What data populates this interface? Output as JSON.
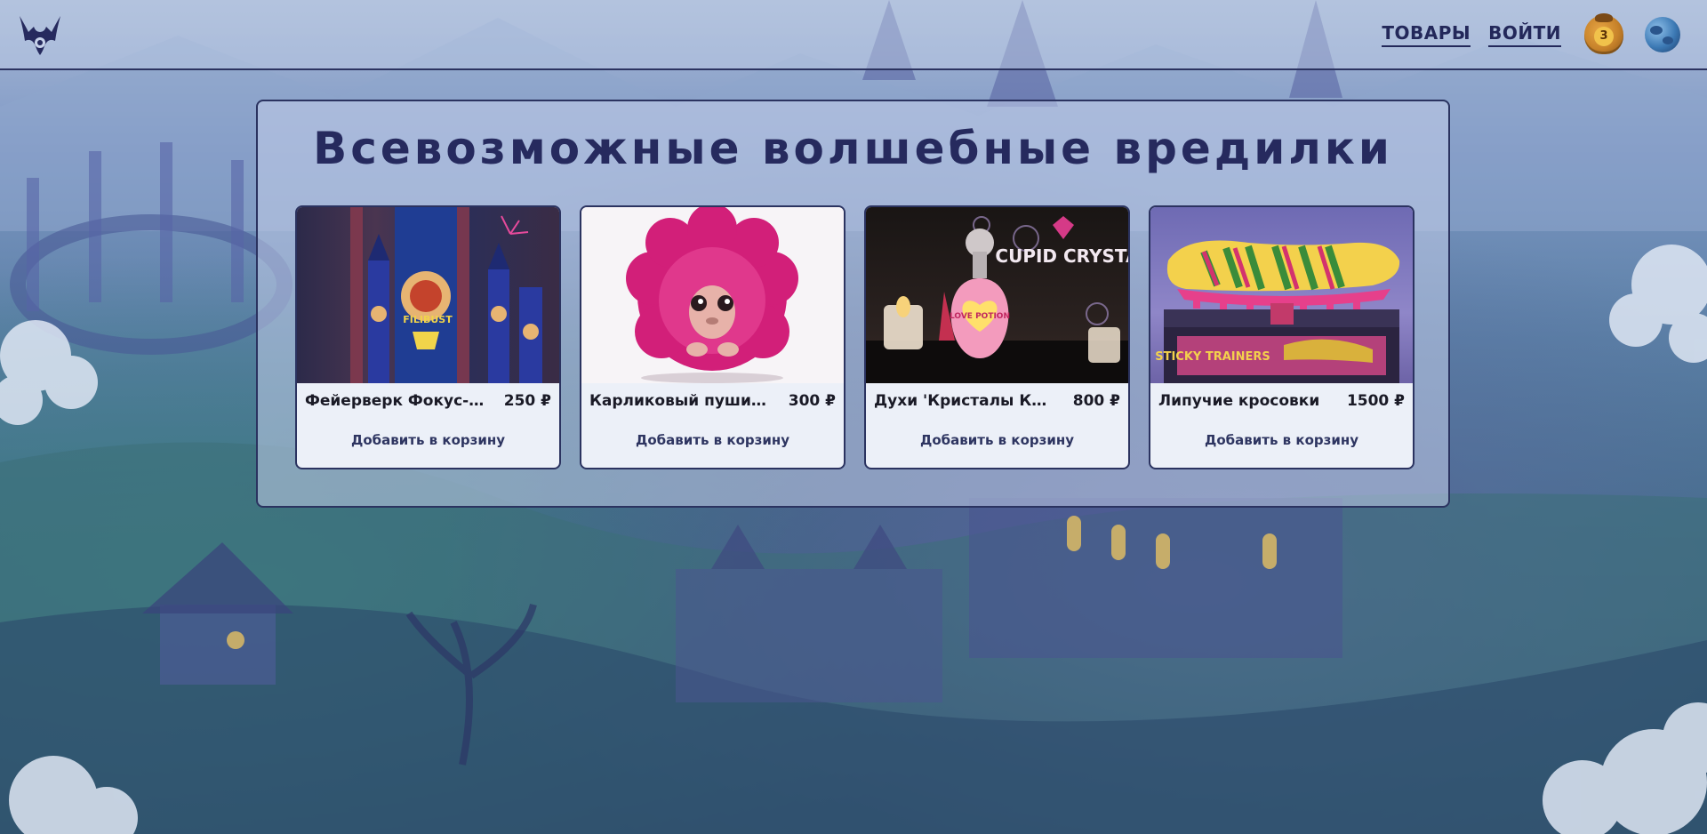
{
  "header": {
    "nav": [
      {
        "label": "ТОВАРЫ"
      },
      {
        "label": "ВОЙТИ"
      }
    ],
    "cart_count": "3"
  },
  "main": {
    "title": "Всевозможные волшебные вредилки",
    "products": [
      {
        "name": "Фейерверк Фокус-по...",
        "price": "250 ₽",
        "button": "Добавить в корзину"
      },
      {
        "name": "Карликовый пушистик",
        "price": "300 ₽",
        "button": "Добавить в корзину"
      },
      {
        "name": "Духи 'Кристалы Купид...",
        "price": "800 ₽",
        "button": "Добавить в корзину"
      },
      {
        "name": "Липучие кросовки",
        "price": "1500 ₽",
        "button": "Добавить в корзину"
      }
    ]
  },
  "images": {
    "fireworks_text": "FILIBUST",
    "perfume_text": "CUPID CRYSTALS",
    "perfume_label": "LOVE POTION",
    "shoe_box_text": "STICKY TRAINERS"
  },
  "colors": {
    "accent": "#262a5e",
    "border": "#2b3360",
    "card_bg": "#ecf0f8"
  }
}
